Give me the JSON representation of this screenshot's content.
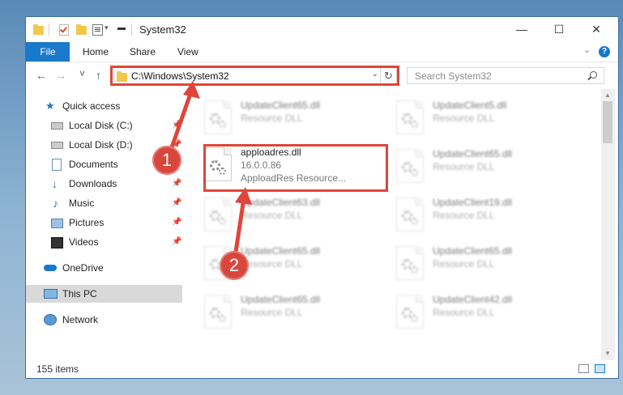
{
  "window": {
    "title": "System32",
    "caption": {
      "minimize": "—",
      "maximize": "☐",
      "close": "✕"
    }
  },
  "ribbon": {
    "tabs": [
      "File",
      "Home",
      "Share",
      "View"
    ],
    "help": "?"
  },
  "navigation": {
    "back": "←",
    "forward": "→",
    "recent": "˅",
    "up": "↑",
    "address_path": "C:\\Windows\\System32",
    "refresh": "↻",
    "search_placeholder": "Search System32"
  },
  "sidebar": {
    "items": [
      {
        "label": "Quick access",
        "icon": "star-icon",
        "pinned": false
      },
      {
        "label": "Local Disk (C:)",
        "icon": "drive-icon",
        "pinned": true
      },
      {
        "label": "Local Disk (D:)",
        "icon": "drive-icon",
        "pinned": true
      },
      {
        "label": "Documents",
        "icon": "documents-icon",
        "pinned": true
      },
      {
        "label": "Downloads",
        "icon": "download-icon",
        "pinned": true
      },
      {
        "label": "Music",
        "icon": "music-icon",
        "pinned": true
      },
      {
        "label": "Pictures",
        "icon": "pictures-icon",
        "pinned": true
      },
      {
        "label": "Videos",
        "icon": "videos-icon",
        "pinned": true
      },
      {
        "label": "OneDrive",
        "icon": "cloud-icon",
        "pinned": false
      },
      {
        "label": "This PC",
        "icon": "computer-icon",
        "pinned": false,
        "selected": true
      },
      {
        "label": "Network",
        "icon": "network-icon",
        "pinned": false
      }
    ]
  },
  "files": [
    {
      "name": "UpdateClient65.dll",
      "type": "Resource DLL"
    },
    {
      "name": "UpdateClient5.dll",
      "type": "Resource DLL"
    },
    {
      "name": "apploadres.dll",
      "version": "16.0.0.86",
      "type": "ApploadRes Resource...",
      "highlighted": true
    },
    {
      "name": "UpdateClient65.dll",
      "type": "Resource DLL"
    },
    {
      "name": "UpdateClient63.dll",
      "type": "Resource DLL"
    },
    {
      "name": "UpdateClient19.dll",
      "type": "Resource DLL"
    },
    {
      "name": "UpdateClient65.dll",
      "type": "Resource DLL"
    },
    {
      "name": "UpdateClient65.dll",
      "type": "Resource DLL"
    },
    {
      "name": "UpdateClient65.dll",
      "type": "Resource DLL"
    },
    {
      "name": "UpdateClient42.dll",
      "type": "Resource DLL"
    }
  ],
  "status": {
    "item_count": "155 items"
  },
  "annotations": {
    "step1": "1",
    "step2": "2"
  },
  "colors": {
    "accent": "#1979ca",
    "highlight": "#e0453b",
    "selected": "#d9d9d9"
  }
}
